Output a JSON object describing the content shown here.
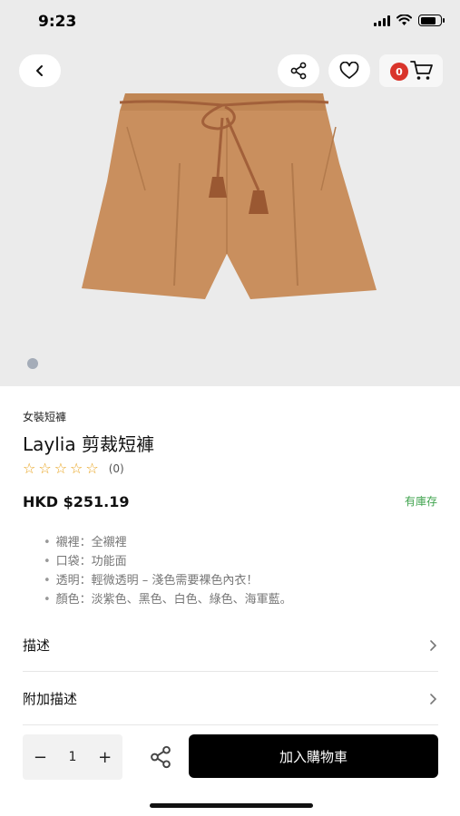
{
  "status_bar": {
    "time": "9:23"
  },
  "header": {
    "cart_count": "0"
  },
  "product": {
    "category": "女裝短褲",
    "title": "Laylia 剪裁短褲",
    "rating_stars": 0,
    "review_count": "(0)",
    "price": "HKD $251.19",
    "stock": "有庫存",
    "features": [
      "襯裡：全襯裡",
      "口袋：功能面",
      "透明：輕微透明 – 淺色需要裸色內衣！",
      "顏色：淡紫色、黑色、白色、綠色、海軍藍。"
    ]
  },
  "sections": {
    "description": "描述",
    "additional": "附加描述"
  },
  "bottom_bar": {
    "quantity": "1",
    "minus": "−",
    "plus": "+",
    "add_to_cart": "加入購物車"
  },
  "icons": {
    "back": "chevron-left-icon",
    "share": "share-icon",
    "like": "heart-icon",
    "cart": "cart-icon"
  },
  "colors": {
    "accent_stock": "#3fa34d",
    "star": "#e8a21a",
    "badge": "#d9342b",
    "product": "#c98f5e"
  }
}
